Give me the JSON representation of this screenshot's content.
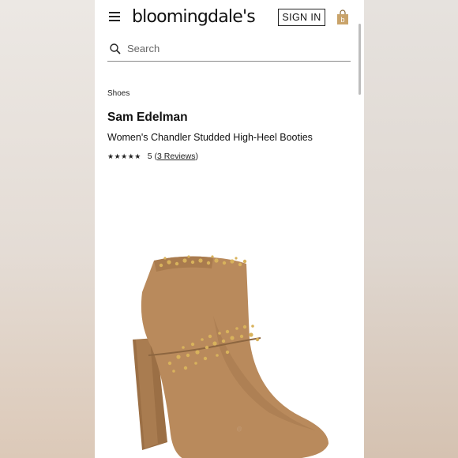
{
  "header": {
    "logo_text": "bloomingdale's",
    "signin_label": "SIGN IN",
    "bag_badge": "b"
  },
  "search": {
    "placeholder": "Search"
  },
  "breadcrumb": "Shoes",
  "product": {
    "brand": "Sam Edelman",
    "title": "Women's Chandler Studded High-Heel Booties",
    "stars": "★★★★★",
    "rating": "5",
    "reviews_label": "3 Reviews",
    "image_alt": "Women's Chandler Studded High-Heel Booties"
  },
  "colors": {
    "suede": "#b98a5c",
    "suede_shadow": "#9b6f45",
    "stud": "#d8b25c",
    "bag": "#c9a36a"
  }
}
